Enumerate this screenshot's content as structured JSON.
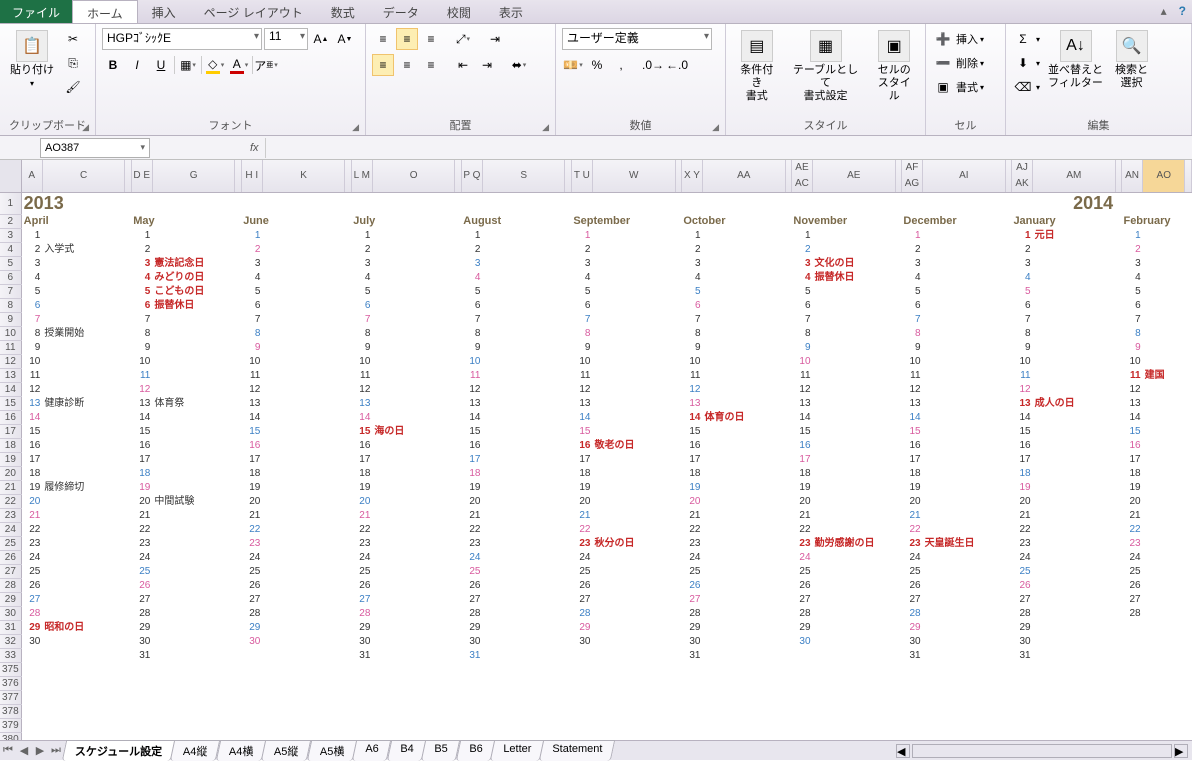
{
  "menu": {
    "file": "ファイル",
    "tabs": [
      "ホーム",
      "挿入",
      "ページ レイアウト",
      "数式",
      "データ",
      "校閲",
      "表示"
    ]
  },
  "ribbon": {
    "clipboard": {
      "paste": "貼り付け",
      "label": "クリップボード"
    },
    "font": {
      "name": "HGPｺﾞｼｯｸE",
      "size": "11",
      "label": "フォント",
      "bold": "B",
      "italic": "I",
      "underline": "U"
    },
    "align": {
      "label": "配置"
    },
    "number": {
      "format": "ユーザー定義",
      "label": "数値"
    },
    "styles": {
      "cond": "条件付き\n書式",
      "table": "テーブルとして\n書式設定",
      "cell": "セルの\nスタイル",
      "label": "スタイル"
    },
    "cells": {
      "insert": "挿入",
      "delete": "削除",
      "format": "書式",
      "label": "セル"
    },
    "editing": {
      "sort": "並べ替えと\nフィルター",
      "find": "検索と\n選択",
      "label": "編集"
    }
  },
  "namebox": "AO387",
  "years": {
    "left": "2013",
    "right": "2014"
  },
  "months": [
    "April",
    "May",
    "June",
    "July",
    "August",
    "September",
    "October",
    "November",
    "December",
    "January",
    "February"
  ],
  "events": {
    "April": {
      "2": "入学式",
      "8": "授業開始",
      "13": "健康診断",
      "19": "履修締切",
      "29": "昭和の日"
    },
    "May": {
      "3": "憲法記念日",
      "4": "みどりの日",
      "5": "こどもの日",
      "6": "振替休日",
      "13": "体育祭",
      "20": "中間試験"
    },
    "July": {
      "15": "海の日"
    },
    "September": {
      "16": "敬老の日",
      "23": "秋分の日"
    },
    "October": {
      "14": "体育の日"
    },
    "November": {
      "3": "文化の日",
      "4": "振替休日",
      "23": "勤労感謝の日"
    },
    "December": {
      "23": "天皇誕生日"
    },
    "January": {
      "1": "元日",
      "13": "成人の日"
    },
    "February": {
      "11": "建国"
    }
  },
  "holidays": {
    "April": [
      29
    ],
    "May": [
      3,
      4,
      5,
      6
    ],
    "July": [
      15
    ],
    "September": [
      16,
      23
    ],
    "October": [
      14
    ],
    "November": [
      3,
      4,
      23
    ],
    "December": [
      23
    ],
    "January": [
      1,
      13
    ],
    "February": [
      11
    ]
  },
  "monthLen": {
    "April": 30,
    "May": 31,
    "June": 30,
    "July": 31,
    "August": 31,
    "September": 30,
    "October": 31,
    "November": 30,
    "December": 31,
    "January": 31,
    "February": 28
  },
  "startDow": {
    "April": 1,
    "May": 3,
    "June": 6,
    "July": 1,
    "August": 4,
    "September": 0,
    "October": 2,
    "November": 5,
    "December": 0,
    "January": 3,
    "February": 6
  },
  "cols": [
    "A",
    "C",
    "D",
    "E",
    "G",
    "H",
    "I",
    "K",
    "L",
    "M",
    "O",
    "P",
    "Q",
    "S",
    "T",
    "U",
    "W",
    "X",
    "Y",
    "AA",
    "AE",
    "AC",
    "AE",
    "AF",
    "AG",
    "AI",
    "AJ",
    "AK",
    "AM",
    "AN",
    "AO"
  ],
  "sheets": [
    "スケジュール設定",
    "A4縦",
    "A4横",
    "A5縦",
    "A5横",
    "A6",
    "B4",
    "B5",
    "B6",
    "Letter",
    "Statement"
  ],
  "activeSheet": 0
}
